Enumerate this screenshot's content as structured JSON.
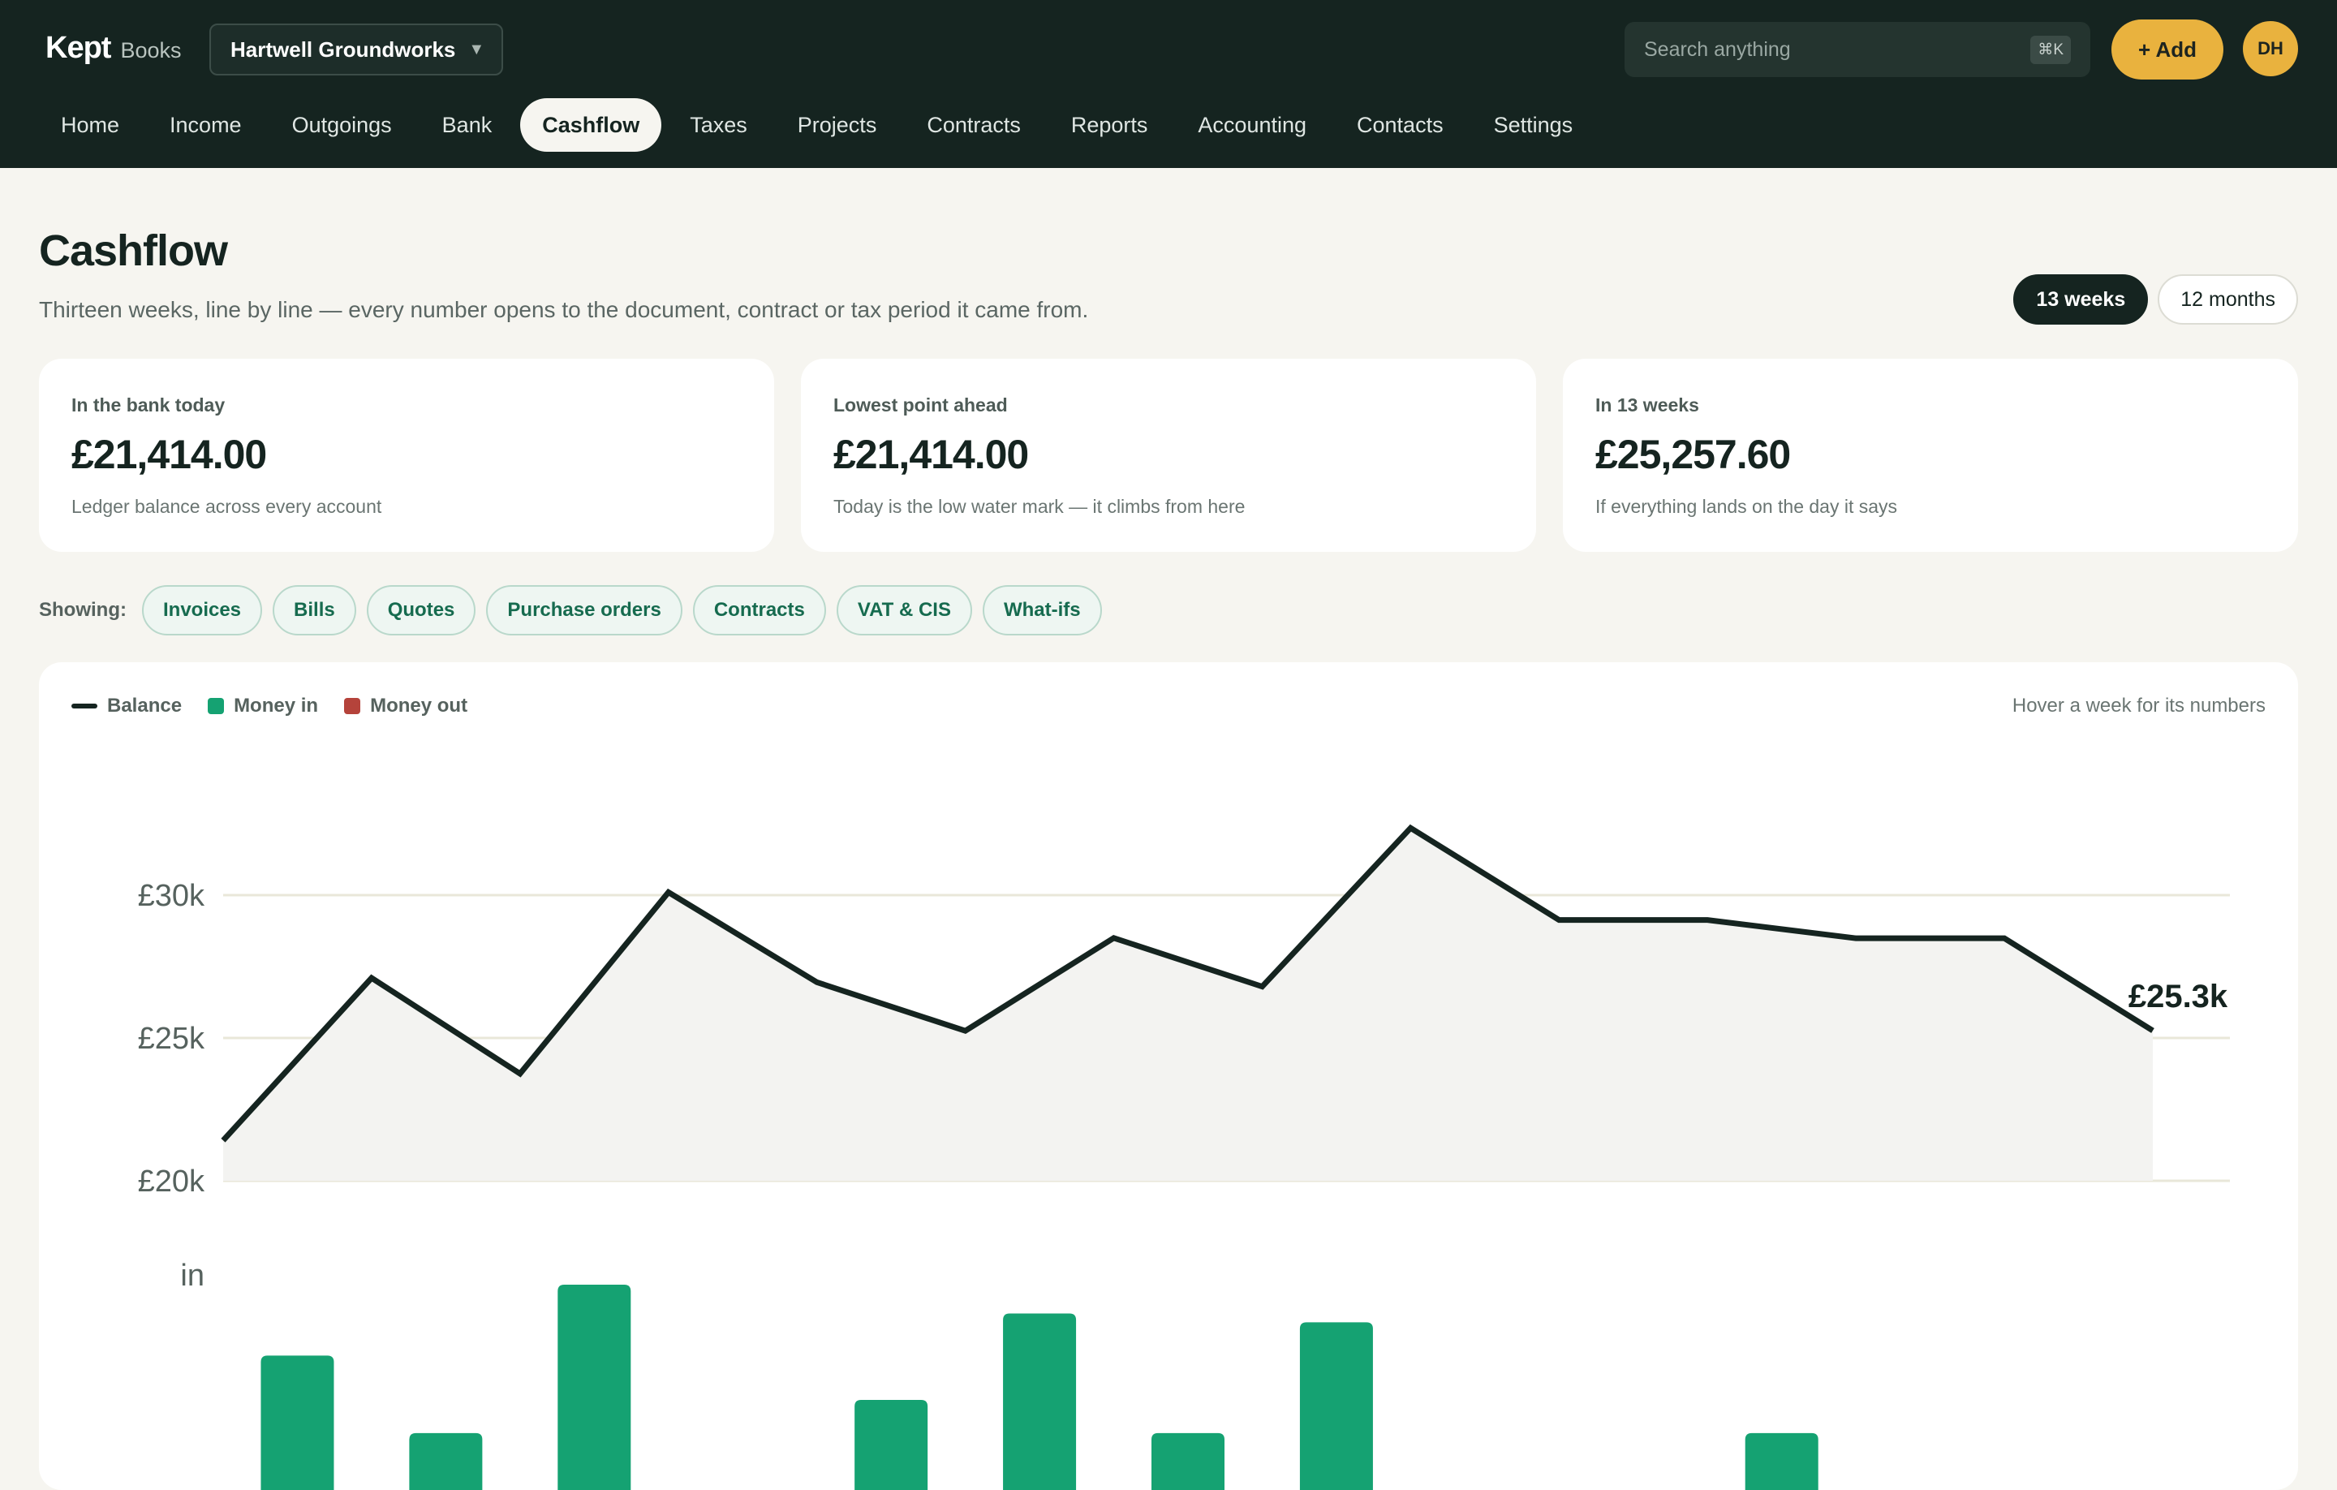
{
  "app": {
    "name": "Kept",
    "product": "Books"
  },
  "org_selector": {
    "value": "Hartwell Groundworks",
    "icon": "chevron-down-icon"
  },
  "search": {
    "placeholder": "Search anything",
    "shortcut": "⌘K"
  },
  "add_button": {
    "label": "+ Add"
  },
  "user": {
    "initials": "DH"
  },
  "nav": {
    "items": [
      "Home",
      "Income",
      "Outgoings",
      "Bank",
      "Cashflow",
      "Taxes",
      "Projects",
      "Contracts",
      "Reports",
      "Accounting",
      "Contacts",
      "Settings"
    ],
    "active": "Cashflow"
  },
  "page": {
    "title": "Cashflow",
    "subtitle": "Thirteen weeks, line by line — every number opens to the document, contract or tax period it came from."
  },
  "range_toggle": {
    "options": [
      "13 weeks",
      "12 months"
    ],
    "selected": "13 weeks"
  },
  "stats": [
    {
      "label": "In the bank today",
      "value": "£21,414.00",
      "note": "Ledger balance across every account"
    },
    {
      "label": "Lowest point ahead",
      "value": "£21,414.00",
      "note": "Today is the low water mark — it climbs from here"
    },
    {
      "label": "In 13 weeks",
      "value": "£25,257.60",
      "note": "If everything lands on the day it says"
    }
  ],
  "filters": {
    "label": "Showing:",
    "chips": [
      "Invoices",
      "Bills",
      "Quotes",
      "Purchase orders",
      "Contracts",
      "VAT & CIS",
      "What-ifs"
    ]
  },
  "chart": {
    "legend": {
      "balance": "Balance",
      "money_in": "Money in",
      "money_out": "Money out"
    },
    "hover_hint": "Hover a week for its numbers"
  },
  "colors": {
    "balance_line": "#152420",
    "money_in": "#15a272",
    "money_out": "#b5433b",
    "accent": "#e9b23e",
    "header_bg": "#152420"
  },
  "chart_data": {
    "type": "line",
    "balance": {
      "x": [
        0,
        1,
        2,
        3,
        4,
        5,
        6,
        7,
        8,
        9,
        10,
        11,
        12,
        13
      ],
      "values": [
        21414,
        27100,
        23750,
        30100,
        26950,
        25250,
        28500,
        26800,
        32350,
        29130,
        29130,
        28490,
        28490,
        25257.6
      ],
      "ylim": [
        20000,
        30000
      ],
      "yticks": [
        "£20k",
        "£25k",
        "£30k"
      ],
      "end_label": "£25.3k"
    },
    "money_in": {
      "row_label": "in",
      "x": [
        0.5,
        1.5,
        2.5,
        3.5,
        4.5,
        5.5,
        6.5,
        7.5,
        8.5,
        9.5,
        10.5,
        11.5,
        12.5
      ],
      "values": [
        0.68,
        0.33,
        1.0,
        0,
        0.48,
        0.87,
        0.33,
        0.83,
        0,
        0,
        0.33,
        0,
        0
      ]
    }
  }
}
